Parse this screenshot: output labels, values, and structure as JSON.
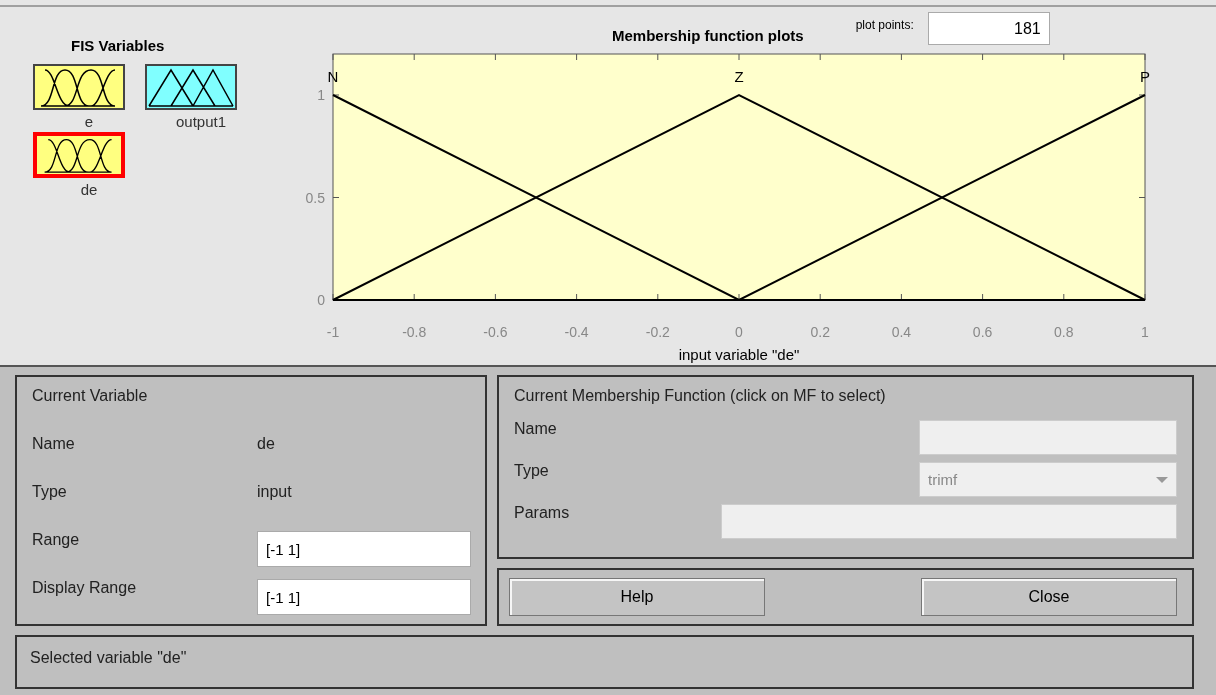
{
  "fis_variables": {
    "title": "FIS Variables",
    "items": [
      {
        "name": "e",
        "kind": "input",
        "selected": false
      },
      {
        "name": "output1",
        "kind": "output",
        "selected": false
      },
      {
        "name": "de",
        "kind": "input",
        "selected": true
      }
    ]
  },
  "plot": {
    "plot_points_label": "plot points:",
    "plot_points": "181",
    "chart_data": {
      "type": "line",
      "title": "Membership function plots",
      "xlabel": "input variable \"de\"",
      "x": [
        -1,
        0,
        1
      ],
      "series": [
        {
          "name": "N",
          "color": "#000000",
          "values": [
            1,
            0,
            0
          ]
        },
        {
          "name": "Z",
          "color": "#000000",
          "values": [
            0,
            1,
            0
          ]
        },
        {
          "name": "P",
          "color": "#000000",
          "values": [
            0,
            0,
            1
          ]
        }
      ],
      "xlim": [
        -1,
        1
      ],
      "ylim": [
        0,
        1.2
      ],
      "xticks": [
        -1,
        -0.8,
        -0.6,
        -0.4,
        -0.2,
        0,
        0.2,
        0.4,
        0.6,
        0.8,
        1
      ],
      "yticks": [
        0,
        0.5,
        1
      ]
    }
  },
  "current_variable": {
    "title": "Current Variable",
    "name_label": "Name",
    "name": "de",
    "type_label": "Type",
    "type": "input",
    "range_label": "Range",
    "range": "[-1 1]",
    "display_range_label": "Display Range",
    "display_range": "[-1 1]"
  },
  "current_mf": {
    "title": "Current Membership Function (click on MF to select)",
    "name_label": "Name",
    "type_label": "Type",
    "type": "trimf",
    "params_label": "Params"
  },
  "buttons": [
    "Help",
    "Close"
  ],
  "status": "Selected variable \"de\""
}
